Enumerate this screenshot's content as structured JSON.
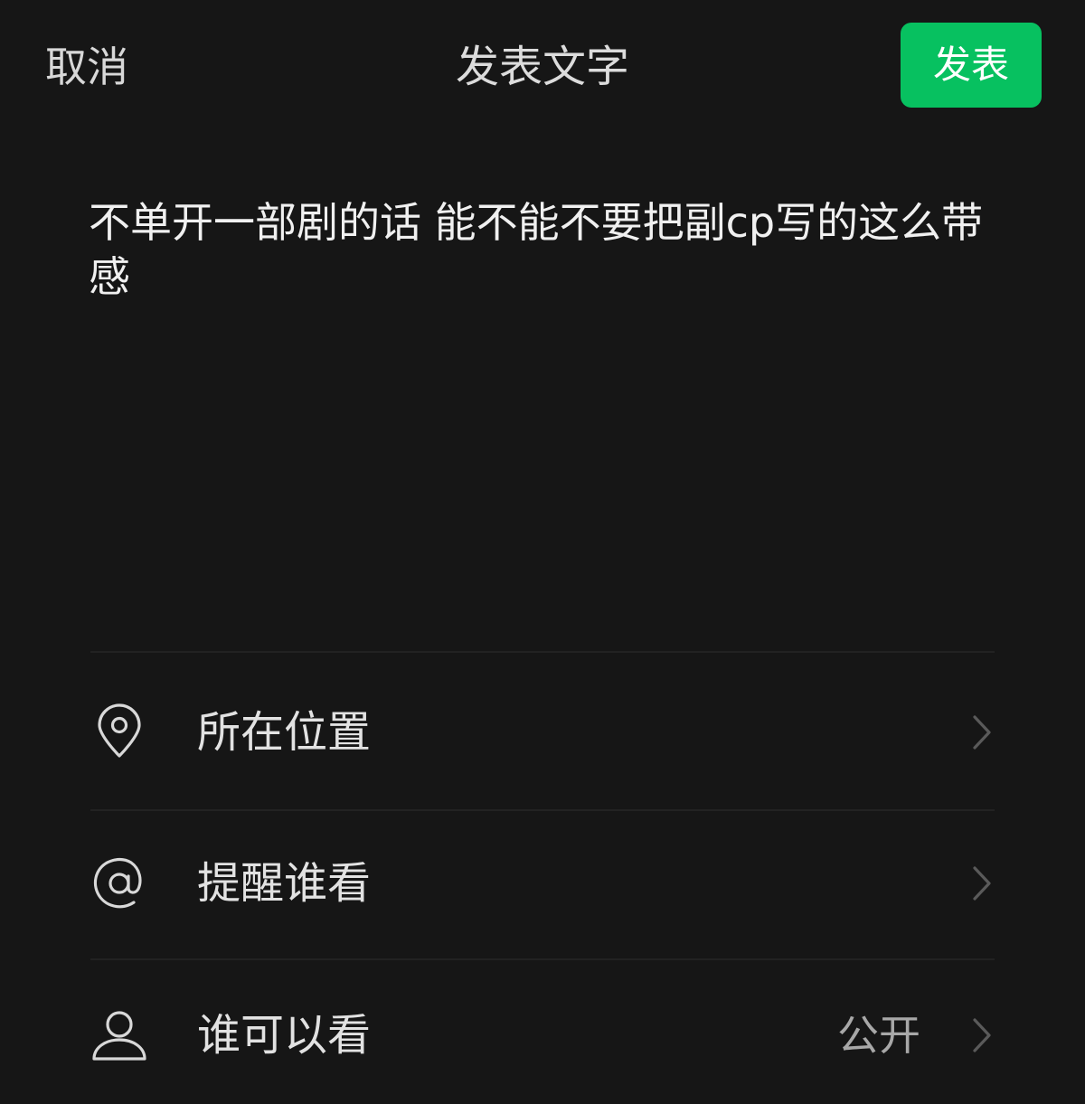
{
  "header": {
    "cancel_label": "取消",
    "title": "发表文字",
    "publish_label": "发表",
    "publish_color": "#07c160"
  },
  "post": {
    "text": "不单开一部剧的话 能不能不要把副cp写的这么带感"
  },
  "options": [
    {
      "icon": "location-pin-icon",
      "label": "所在位置",
      "value": ""
    },
    {
      "icon": "at-sign-icon",
      "label": "提醒谁看",
      "value": ""
    },
    {
      "icon": "person-icon",
      "label": "谁可以看",
      "value": "公开"
    }
  ]
}
